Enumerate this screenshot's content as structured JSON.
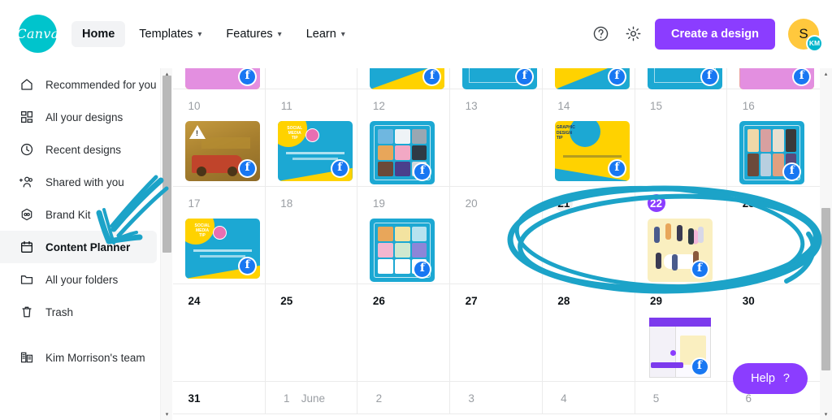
{
  "header": {
    "logo_text": "Canva",
    "logo_icon": "canva-logo-icon",
    "nav": [
      {
        "label": "Home",
        "caret": "",
        "active": true
      },
      {
        "label": "Templates",
        "caret": "⌄",
        "active": false
      },
      {
        "label": "Features",
        "caret": "⌄",
        "active": false
      },
      {
        "label": "Learn",
        "caret": "⌄",
        "active": false
      }
    ],
    "help_icon": "question-circle-icon",
    "settings_icon": "gear-icon",
    "cta_label": "Create a design",
    "avatar_initial": "S",
    "avatar_badge": "KM",
    "brand_color": "#00C4CC",
    "accent_color": "#8B3DFF"
  },
  "sidebar": {
    "items": [
      {
        "label": "Recommended for you",
        "icon": "home-icon",
        "active": false
      },
      {
        "label": "All your designs",
        "icon": "grid-icon",
        "active": false
      },
      {
        "label": "Recent designs",
        "icon": "clock-icon",
        "active": false
      },
      {
        "label": "Shared with you",
        "icon": "shared-users-icon",
        "active": false
      },
      {
        "label": "Brand Kit",
        "icon": "brand-kit-icon",
        "active": false
      },
      {
        "label": "Content Planner",
        "icon": "calendar-icon",
        "active": true
      },
      {
        "label": "All your folders",
        "icon": "folder-icon",
        "active": false
      },
      {
        "label": "Trash",
        "icon": "trash-icon",
        "active": false
      }
    ],
    "team": {
      "label": "Kim Morrison's team",
      "icon": "building-icon"
    }
  },
  "calendar": {
    "month_label": "June",
    "today_color": "#efefef",
    "selected_color": "#8B3DFF",
    "rows": [
      {
        "clipped": true,
        "cells": [
          {
            "day": "",
            "state": "muted",
            "thumb": "stripe1",
            "social": "facebook"
          },
          {
            "day": "",
            "state": "muted",
            "thumb": "",
            "social": ""
          },
          {
            "day": "",
            "state": "muted",
            "thumb": "stripe2",
            "social": "facebook"
          },
          {
            "day": "",
            "state": "muted",
            "thumb": "stripe3",
            "social": "facebook"
          },
          {
            "day": "",
            "state": "muted",
            "thumb": "stripe4",
            "social": "facebook"
          },
          {
            "day": "",
            "state": "muted",
            "thumb": "stripe3",
            "social": "facebook"
          },
          {
            "day": "",
            "state": "muted",
            "thumb": "stripe1",
            "social": "facebook"
          }
        ]
      },
      {
        "clipped": false,
        "cells": [
          {
            "day": "10",
            "state": "muted",
            "thumb": "truck",
            "social": "facebook",
            "warning": true
          },
          {
            "day": "11",
            "state": "muted",
            "thumb": "bluetip",
            "social": "facebook",
            "thumb_title": "SOCIAL MEDIA TIP"
          },
          {
            "day": "12",
            "state": "muted",
            "thumb": "grid-cats",
            "social": "facebook"
          },
          {
            "day": "13",
            "state": "muted",
            "thumb": "",
            "social": ""
          },
          {
            "day": "14",
            "state": "muted",
            "thumb": "yellowtip",
            "social": "facebook",
            "thumb_title": "GRAPHIC DESIGN TIP"
          },
          {
            "day": "15",
            "state": "muted",
            "thumb": "",
            "social": ""
          },
          {
            "day": "16",
            "state": "muted",
            "thumb": "grid-people",
            "social": "facebook"
          }
        ]
      },
      {
        "clipped": false,
        "cells": [
          {
            "day": "17",
            "state": "muted",
            "thumb": "bluetip",
            "social": "facebook",
            "thumb_title": "SOCIAL MEDIA TIP"
          },
          {
            "day": "18",
            "state": "muted",
            "thumb": "",
            "social": ""
          },
          {
            "day": "19",
            "state": "muted",
            "thumb": "grid-cupcakes",
            "social": "facebook"
          },
          {
            "day": "20",
            "state": "muted",
            "thumb": "",
            "social": ""
          },
          {
            "day": "21",
            "state": "today",
            "thumb": "",
            "social": ""
          },
          {
            "day": "22",
            "state": "selected",
            "thumb": "people",
            "social": "facebook"
          },
          {
            "day": "23",
            "state": "dark",
            "thumb": "",
            "social": ""
          }
        ]
      },
      {
        "clipped": false,
        "cells": [
          {
            "day": "24",
            "state": "dark",
            "thumb": "",
            "social": ""
          },
          {
            "day": "25",
            "state": "dark",
            "thumb": "",
            "social": ""
          },
          {
            "day": "26",
            "state": "dark",
            "thumb": "",
            "social": ""
          },
          {
            "day": "27",
            "state": "dark",
            "thumb": "",
            "social": ""
          },
          {
            "day": "28",
            "state": "dark",
            "thumb": "",
            "social": ""
          },
          {
            "day": "29",
            "state": "dark",
            "thumb": "screens",
            "social": "facebook"
          },
          {
            "day": "30",
            "state": "dark",
            "thumb": "",
            "social": ""
          }
        ]
      },
      {
        "clipped": false,
        "cells": [
          {
            "day": "31",
            "state": "dark",
            "thumb": "",
            "social": ""
          },
          {
            "day": "1",
            "state": "muted",
            "month": "June",
            "thumb": "",
            "social": ""
          },
          {
            "day": "2",
            "state": "muted",
            "thumb": "",
            "social": ""
          },
          {
            "day": "3",
            "state": "muted",
            "thumb": "",
            "social": ""
          },
          {
            "day": "4",
            "state": "muted",
            "thumb": "",
            "social": ""
          },
          {
            "day": "5",
            "state": "muted",
            "thumb": "",
            "social": ""
          },
          {
            "day": "6",
            "state": "muted",
            "thumb": "",
            "social": ""
          }
        ]
      }
    ]
  },
  "help": {
    "label": "Help",
    "mark": "?"
  },
  "annotation": {
    "color": "#1CA3C8",
    "shapes": [
      "arrow-pointing-to-brand-kit",
      "ellipse-around-week-21-23"
    ]
  },
  "scrollbars": {
    "sidebar_up_arrow": "▴",
    "sidebar_down_arrow": "▾",
    "calendar_up_arrow": "▴",
    "calendar_down_arrow": "▾"
  }
}
